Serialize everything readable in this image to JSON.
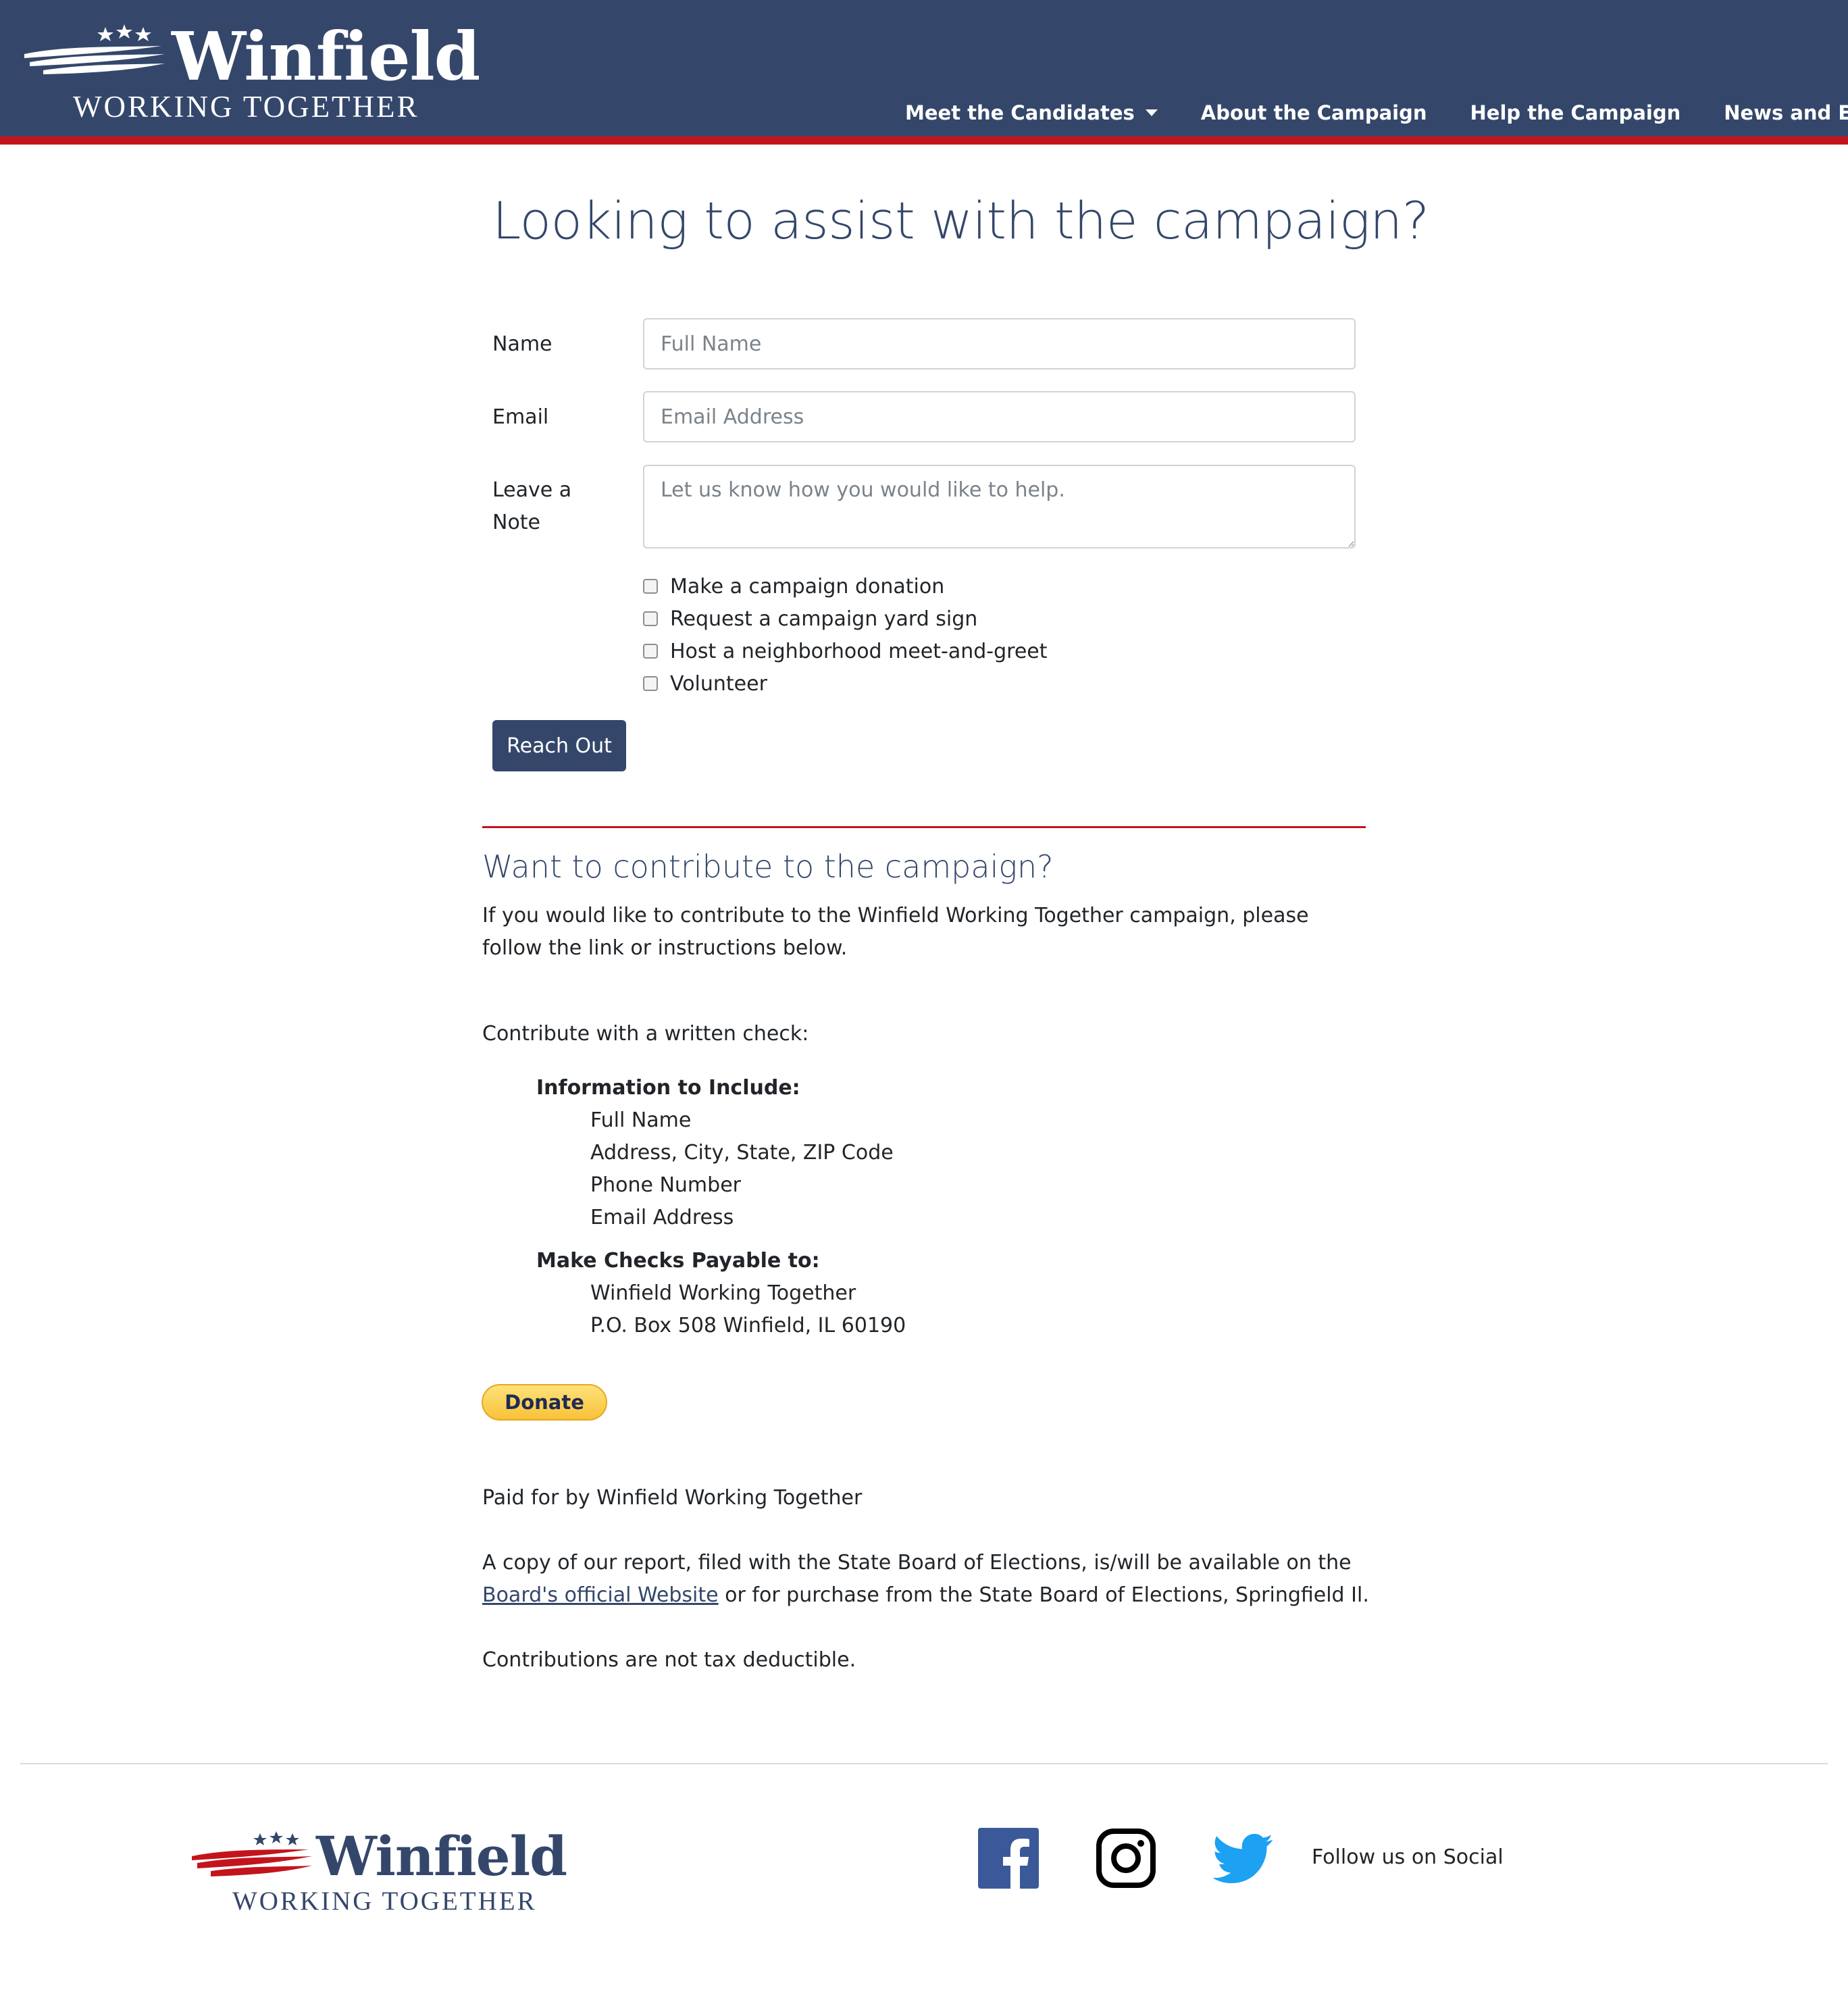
{
  "colors": {
    "brand_navy": "#34476b",
    "accent_red": "#c3141c",
    "donate_yellow": "#f8c23a",
    "facebook_blue": "#3b5998",
    "twitter_blue": "#1da1f2"
  },
  "header": {
    "logo": {
      "word": "Winfield",
      "tagline": "WORKING TOGETHER"
    },
    "nav": [
      {
        "label": "Meet the Candidates",
        "has_dropdown": true
      },
      {
        "label": "About the Campaign"
      },
      {
        "label": "Help the Campaign"
      },
      {
        "label": "News and Events"
      }
    ]
  },
  "form": {
    "title": "Looking to assist with the campaign?",
    "name": {
      "label": "Name",
      "placeholder": "Full Name",
      "value": ""
    },
    "email": {
      "label": "Email",
      "placeholder": "Email Address",
      "value": ""
    },
    "note": {
      "label": "Leave a Note",
      "placeholder": "Let us know how you would like to help.",
      "value": ""
    },
    "options": [
      {
        "label": "Make a campaign donation",
        "checked": false
      },
      {
        "label": "Request a campaign yard sign",
        "checked": false
      },
      {
        "label": "Host a neighborhood meet-and-greet",
        "checked": false
      },
      {
        "label": "Volunteer",
        "checked": false
      }
    ],
    "submit_label": "Reach Out"
  },
  "contribute": {
    "title": "Want to contribute to the campaign?",
    "intro": "If you would like to contribute to the Winfield Working Together campaign, please follow the link or instructions below.",
    "check_heading": "Contribute with a written check:",
    "info_heading": "Information to Include:",
    "info_items": [
      "Full Name",
      "Address, City, State, ZIP Code",
      "Phone Number",
      "Email Address"
    ],
    "payable_heading": "Make Checks Payable to:",
    "payable_items": [
      "Winfield Working Together",
      "P.O. Box 508 Winfield, IL 60190"
    ],
    "donate_label": "Donate",
    "paid_for": "Paid for by Winfield Working Together",
    "report_before": "A copy of our report, filed with the State Board of Elections, is/will be available on the",
    "report_link": "Board's official Website",
    "report_after": "or for purchase from the State Board of Elections, Springfield Il.",
    "tax_note": "Contributions are not tax deductible."
  },
  "footer": {
    "logo": {
      "word": "Winfield",
      "tagline": "WORKING TOGETHER"
    },
    "social_icons": [
      "facebook-icon",
      "instagram-icon",
      "twitter-icon"
    ],
    "follow_text": "Follow us on Social"
  }
}
